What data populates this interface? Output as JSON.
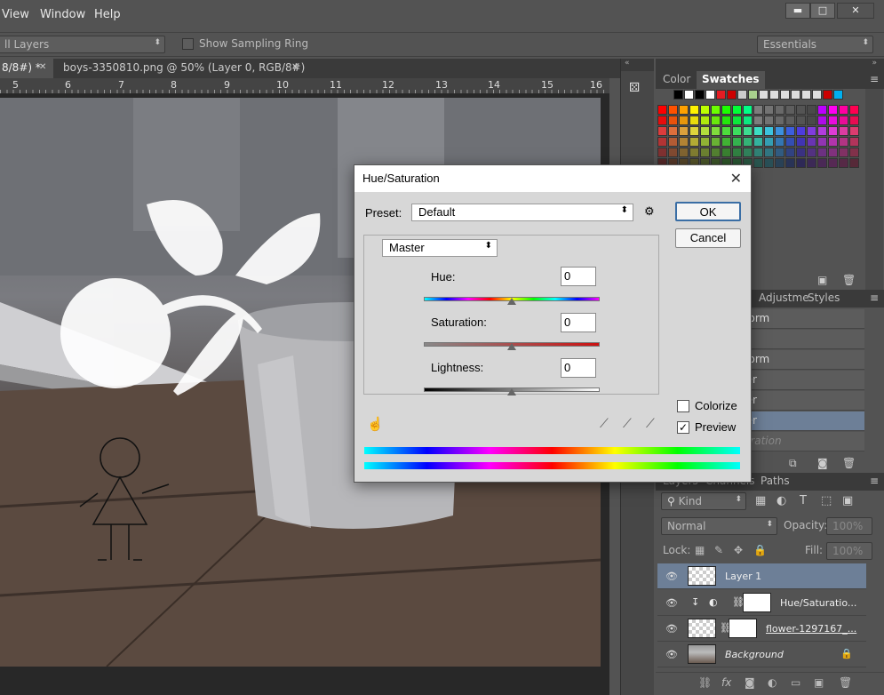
{
  "menubar": {
    "items": [
      "View",
      "Window",
      "Help"
    ]
  },
  "options": {
    "sample_layers": "ll Layers",
    "sampling_ring": "Show Sampling Ring",
    "workspace": "Essentials"
  },
  "tabs": {
    "tab1": "8/8#) *",
    "tab2": "boys-3350810.png @ 50% (Layer 0, RGB/8#)"
  },
  "ruler": {
    "labels": [
      "5",
      "6",
      "7",
      "8",
      "9",
      "10",
      "11",
      "12",
      "13",
      "14",
      "15",
      "16"
    ]
  },
  "color_panel": {
    "tab_color": "Color",
    "tab_swatches": "Swatches"
  },
  "adjust_panel": {
    "tab_adjustments": "Adjustme",
    "tab_styles": "Styles",
    "rows": [
      "sform",
      "",
      "sform",
      "der",
      "der",
      "der",
      "turation"
    ]
  },
  "layers_panel": {
    "tab_layers": "Layers",
    "tab_channels": "Channels",
    "tab_paths": "Paths",
    "kind": "Kind",
    "blend_mode": "Normal",
    "opacity_label": "Opacity:",
    "opacity_value": "100%",
    "lock_label": "Lock:",
    "fill_label": "Fill:",
    "fill_value": "100%",
    "layers": [
      {
        "name": "Layer 1"
      },
      {
        "name": "Hue/Saturatio..."
      },
      {
        "name": "flower-1297167_..."
      },
      {
        "name": "Background"
      }
    ]
  },
  "dialog": {
    "title": "Hue/Saturation",
    "preset_label": "Preset:",
    "preset_value": "Default",
    "ok": "OK",
    "cancel": "Cancel",
    "channel": "Master",
    "hue_label": "Hue:",
    "hue_value": "0",
    "saturation_label": "Saturation:",
    "saturation_value": "0",
    "lightness_label": "Lightness:",
    "lightness_value": "0",
    "colorize_label": "Colorize",
    "colorize_checked": false,
    "preview_label": "Preview",
    "preview_checked": true
  },
  "colors": {
    "accent_selected_layer": "#6d7f97",
    "panel_bg": "#535353"
  }
}
